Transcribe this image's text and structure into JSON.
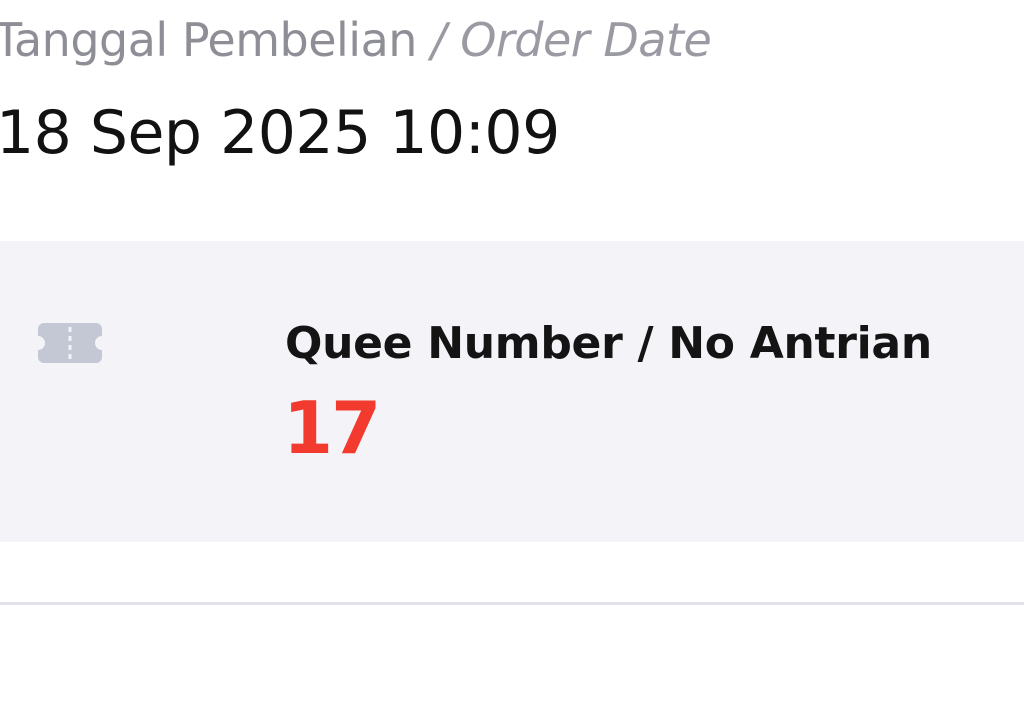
{
  "order_date": {
    "label_primary": "Tanggal Pembelian",
    "label_separator": " / ",
    "label_secondary": "Order Date",
    "value": "18 Sep 2025 10:09"
  },
  "queue": {
    "icon": "ticket-icon",
    "label": "Quee Number / No Antrian",
    "number": "17"
  },
  "colors": {
    "label_gray": "#8e8e96",
    "value_text": "#121212",
    "card_background": "#f4f4f8",
    "queue_number_red": "#f23a2e",
    "icon_gray": "#c3c8d4",
    "divider": "#e3e1ea"
  }
}
